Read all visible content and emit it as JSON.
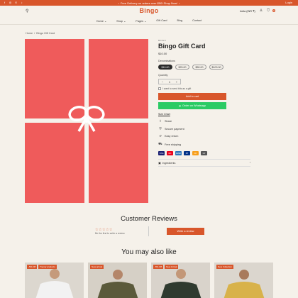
{
  "topbar": {
    "message": "Free Delivery on orders over $50! Shop Now!",
    "login": "Login",
    "socials": [
      "facebook-icon",
      "instagram-icon",
      "x-icon",
      "tiktok-icon"
    ]
  },
  "header": {
    "logo": "Bingo",
    "currency": "India (INR ₹)",
    "cart_count": "0"
  },
  "nav": {
    "items": [
      "Home ⌄",
      "Shop ⌄",
      "Pages ⌄",
      "Gift Card",
      "Blog",
      "Contact"
    ]
  },
  "breadcrumb": {
    "home": "Home",
    "sep": "/",
    "current": "Bingo Gift Card"
  },
  "product": {
    "vendor": "BINGO",
    "title": "Bingo Gift Card",
    "price": "$10.00",
    "denominations_label": "Denominations",
    "denominations": [
      "$10.00",
      "$25.00",
      "$50.00",
      "$100.00"
    ],
    "selected_denomination": "$10.00",
    "quantity_label": "Quantity",
    "quantity": "1",
    "gift_check_label": "I want to send this as a gift",
    "add_to_cart": "Add to cart",
    "whatsapp": "Order on Whatsapp",
    "size_chart": "Size Chart",
    "features": [
      "Share",
      "Secure payment",
      "Easy return",
      "Free shipping"
    ],
    "payment_methods": [
      "VISA",
      "MC",
      "AMEX",
      "PP",
      "DC",
      "GP"
    ],
    "ingredients": "Ingredients"
  },
  "reviews": {
    "title": "Customer Reviews",
    "stars": "☆☆☆☆☆",
    "first_text": "Be the first to write a review",
    "write_button": "Write a review"
  },
  "also_like": {
    "title": "You may also like",
    "cards": [
      {
        "badges": [
          "-5% Off",
          "Trendy products"
        ]
      },
      {
        "badges": [
          "New arrival"
        ]
      },
      {
        "badges": [
          "-5% Off",
          "New Arrival"
        ]
      },
      {
        "badges": [
          "New Collection"
        ]
      }
    ]
  },
  "colors": {
    "accent": "#d8562b",
    "gift_card": "#ef5b5b",
    "whatsapp": "#2bcb64",
    "background": "#f5f1ea"
  }
}
